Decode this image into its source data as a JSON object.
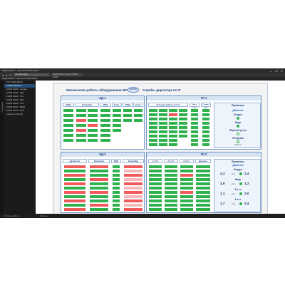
{
  "app": {
    "title": "PageSCADA — Цех КСУ МОФ №123",
    "tab": "ГК-мониторинг",
    "address": "PageSCADA > Цех КСУ МОФ №123",
    "path": "PageSCADA > Цех КСУ МОФ №123",
    "window_buttons": [
      "—",
      "☐",
      "✕"
    ]
  },
  "sidebar": {
    "vertical_tab": "Проводник",
    "items": [
      "КСУ МОФ №123",
      "Обзор рабочего",
      "МОФ №123 - Склады",
      "МОФ №123 - КД-1",
      "МОФ №123 - ГК-1",
      "МОФ №123 - КД-2",
      "МОФ №123 - ГК-2",
      "МОФ №123 - МШЦ",
      "МОФ №123 - Флот",
      "Журнал событий"
    ]
  },
  "status": {
    "left": "Готово к работе",
    "right": "Объекты"
  },
  "scada": {
    "title": "Мнемосхема работы оборудования МОФ123",
    "logo": "ЗОЛОТО",
    "subtitle": "Службы директора по IT",
    "kd1": {
      "title": "КД-1",
      "headers": [
        "ВКД",
        "Конвейер",
        "МКД",
        "Конв.",
        "КМД",
        "Конв."
      ]
    },
    "gk1": {
      "title": "ГК-1",
      "headers": [
        "Мельницы верхнего уступа",
        "Колос. конв.",
        "Сепарат. конв.",
        "Параметры"
      ]
    },
    "kd2": {
      "title": "КД-2",
      "headers": [
        "Дробилки",
        "Конвейер",
        "ВКД",
        "Конвейер"
      ]
    },
    "gk2": {
      "title": "ГК-2",
      "headers": [
        "1-я Ст.",
        "2-я Ст.",
        "3-я Ст.",
        "Дренаж.",
        "Параметры"
      ]
    },
    "params1": {
      "pressure": "Давление",
      "air": "Воздух",
      "water": "Вода",
      "upper": "Верхний уступ",
      "press_opt": "Разгрузка",
      "vacuum_opt": "Вакуум"
    },
    "params2": {
      "title": "Параметры",
      "pressure": "Давление",
      "air": "Воздух",
      "air_v1": "4,3",
      "air_v2": "2,4",
      "water": "Вода",
      "water_v1": "3,9",
      "water_v2": "1,2",
      "line3": "3-я ст",
      "line3_v1": "1,1",
      "line3_v2": "2,0",
      "line4": "4-я ст",
      "line4_v1": "1,7",
      "line4_v2": "2,4",
      "unit": "атм"
    }
  }
}
